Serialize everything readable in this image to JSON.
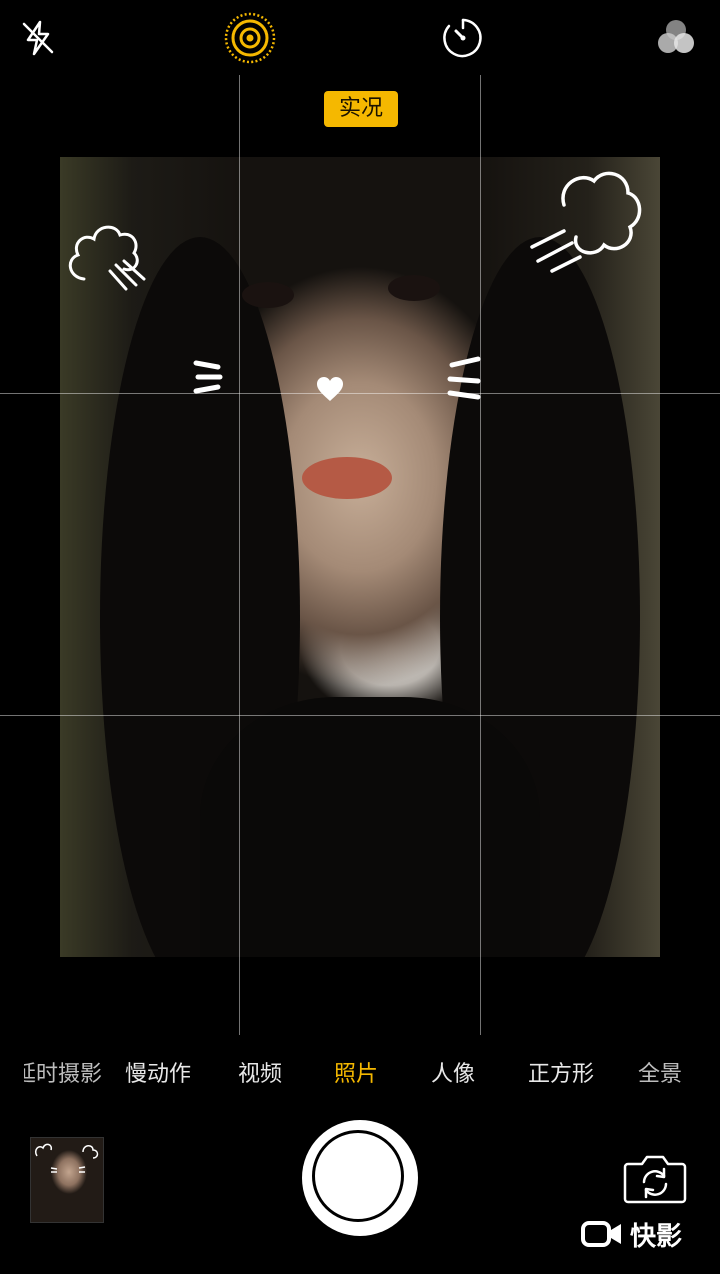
{
  "top_bar": {
    "flash_icon": "flash-off-icon",
    "live_icon": "live-photo-icon",
    "timer_icon": "timer-icon",
    "filters_icon": "filters-icon",
    "accent_color": "#f5b800"
  },
  "live_badge": {
    "label": "实况"
  },
  "modes": [
    {
      "label": "延时摄影"
    },
    {
      "label": "慢动作"
    },
    {
      "label": "视频"
    },
    {
      "label": "照片",
      "active": true
    },
    {
      "label": "人像"
    },
    {
      "label": "正方形"
    },
    {
      "label": "全景"
    }
  ],
  "bottom": {
    "flip_icon": "camera-flip-icon"
  },
  "watermark": {
    "label": "快影",
    "icon": "kuaiying-logo-icon"
  }
}
